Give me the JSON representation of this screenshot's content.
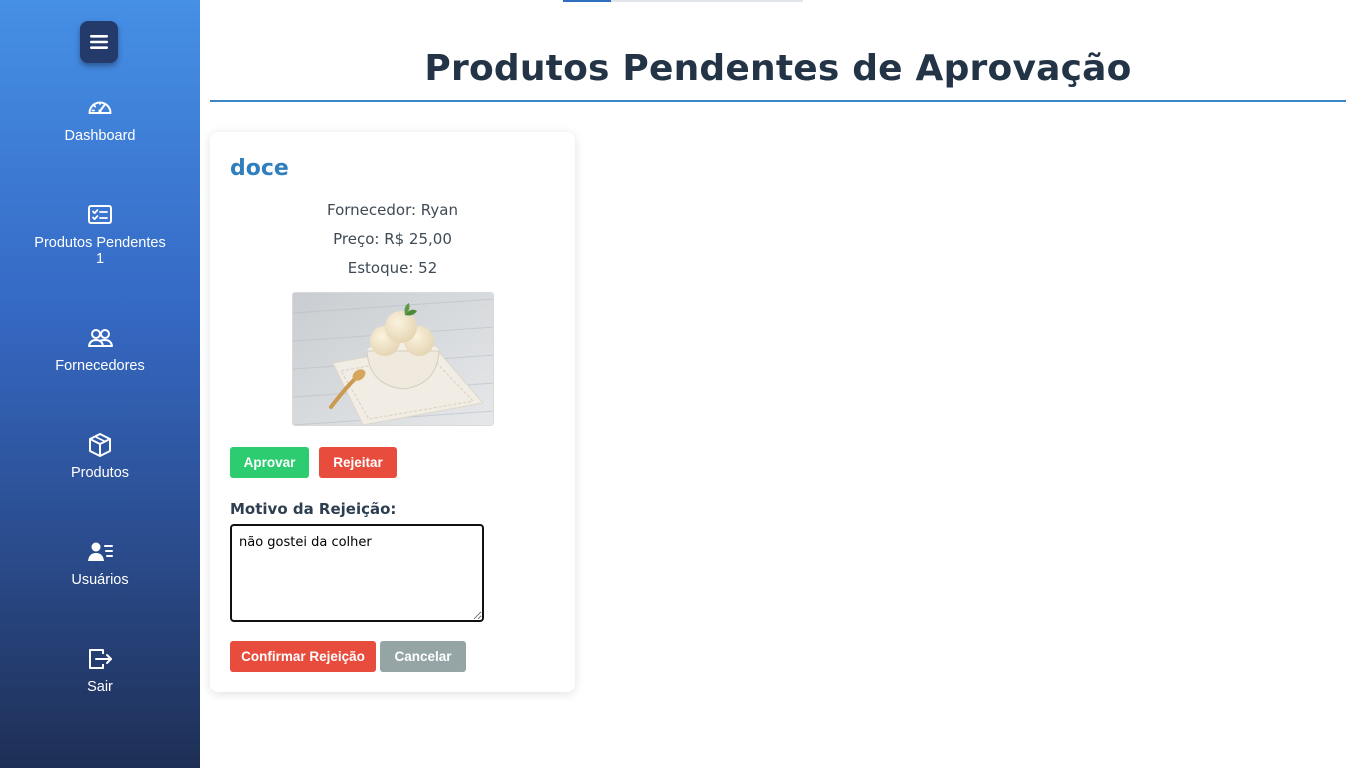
{
  "sidebar": {
    "toggle_icon": "hamburger-icon",
    "items": [
      {
        "label": "Dashboard",
        "icon": "gauge-icon"
      },
      {
        "label": "Produtos Pendentes 1",
        "icon": "checklist-icon"
      },
      {
        "label": "Fornecedores",
        "icon": "users-icon"
      },
      {
        "label": "Produtos",
        "icon": "box-icon"
      },
      {
        "label": "Usuários",
        "icon": "user-list-icon"
      },
      {
        "label": "Sair",
        "icon": "logout-icon"
      }
    ]
  },
  "header": {
    "title": "Produtos Pendentes de Aprovação",
    "progress_fraction": 0.2
  },
  "product": {
    "name": "doce",
    "supplier": "Fornecedor: Ryan",
    "price": "Preço: R$ 25,00",
    "stock": "Estoque: 52",
    "image": "ice-cream-bowl-photo",
    "approve_label": "Aprovar",
    "reject_label": "Rejeitar",
    "reason_label": "Motivo da Rejeição:",
    "reason_value": "não gostei da colher",
    "confirm_label": "Confirmar Rejeição",
    "cancel_label": "Cancelar"
  },
  "colors": {
    "sidebar_top": "#4690e6",
    "sidebar_bottom": "#1e2f55",
    "title": "#243447",
    "accent": "#2f7fbf",
    "approve": "#2ecc71",
    "reject": "#e74c3c",
    "cancel": "#95a5a6"
  }
}
